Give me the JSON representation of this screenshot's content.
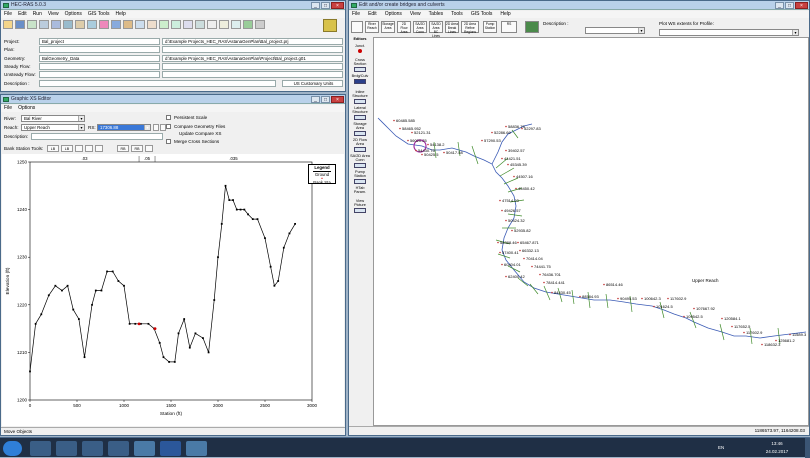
{
  "main": {
    "title": "HEC-RAS 5.0.3",
    "menu": [
      "File",
      "Edit",
      "Run",
      "View",
      "Options",
      "GIS Tools",
      "Help"
    ],
    "fields": [
      {
        "label": "Project:",
        "value": "Bal_project",
        "path": "d:\\Example Projects_HEC_RAS\\AstanaGenPlan\\Bal_project.prj"
      },
      {
        "label": "Plan:",
        "value": "",
        "path": ""
      },
      {
        "label": "Geometry:",
        "value": "BalGeometry_Data",
        "path": "d:\\Example Projects_HEC_RAS\\AstanaGenPlan\\Project\\Bal_project.g01"
      },
      {
        "label": "Steady Flow:",
        "value": "",
        "path": ""
      },
      {
        "label": "Unsteady Flow:",
        "value": "",
        "path": ""
      },
      {
        "label": "Description :",
        "value": "",
        "path": ""
      }
    ],
    "units": "US Customary Units"
  },
  "xs": {
    "title": "Graphic XS Editor",
    "menu": [
      "File",
      "Options"
    ],
    "river_label": "River:",
    "river": "Bal River",
    "reach_label": "Reach:",
    "reach": "Upper Reach",
    "rs_label": "RS:",
    "rs": "17306.88",
    "description_label": "Description:",
    "options": [
      "Persistent Scale",
      "Compare Geometry Files",
      "Update Compare XS",
      "Merge Cross Sections"
    ],
    "bank_tools_label": "Bank Station Tools:",
    "bank_buttons": [
      "LB",
      "LB",
      "RB",
      "RB"
    ],
    "regions": [
      ".03",
      ".05",
      ".035"
    ],
    "legend_title": "Legend",
    "legend_items": [
      "Ground",
      "Bank Sta"
    ],
    "status": "Move Objects"
  },
  "chart_data": {
    "type": "line",
    "title": "",
    "xlabel": "Station (ft)",
    "ylabel": "Elevation (ft)",
    "xlim": [
      0,
      3000
    ],
    "ylim": [
      1200,
      1250
    ],
    "xticks": [
      0,
      500,
      1000,
      1500,
      2000,
      2500,
      3000
    ],
    "yticks": [
      1200,
      1210,
      1220,
      1230,
      1240,
      1250
    ],
    "series": [
      {
        "name": "Ground",
        "x": [
          0,
          60,
          120,
          200,
          270,
          340,
          400,
          460,
          520,
          580,
          660,
          700,
          760,
          820,
          880,
          940,
          1000,
          1060,
          1120,
          1180,
          1260,
          1320,
          1380,
          1420,
          1480,
          1540,
          1580,
          1640,
          1700,
          1760,
          1840,
          1900,
          1960,
          2000,
          2040,
          2080,
          2120,
          2160,
          2200,
          2240,
          2280,
          2320,
          2370,
          2420,
          2500,
          2560,
          2600,
          2640,
          2700,
          2760,
          2820
        ],
        "y": [
          1206,
          1216,
          1218,
          1222,
          1224,
          1223,
          1224,
          1219,
          1217,
          1209,
          1220,
          1223,
          1223,
          1227,
          1227,
          1225,
          1224,
          1216,
          1216,
          1216,
          1216,
          1215,
          1212,
          1209,
          1208,
          1208,
          1214,
          1217,
          1211,
          1214,
          1213,
          1210,
          1221,
          1230,
          1237,
          1245,
          1242,
          1242,
          1240,
          1240,
          1240,
          1239,
          1238,
          1238,
          1234,
          1228,
          1224,
          1225,
          1232,
          1235,
          1237
        ]
      }
    ],
    "bank_stations": [
      1160,
      1330
    ]
  },
  "geo": {
    "title": "Edit and/or create bridges and culverts",
    "menu": [
      "File",
      "Edit",
      "Options",
      "View",
      "Tables",
      "Tools",
      "GIS Tools",
      "Help"
    ],
    "description_label": "Description :",
    "plot_label": "Plot WS extents for Profile:",
    "toolbar": [
      "River Reach",
      "Storage Area",
      "2D Flow Area",
      "SA/2D Area Conn",
      "SA/2D Area BC Lines",
      "2D Area Break Lines",
      "2D Area Refine Regions",
      "Pump Station",
      "RS"
    ],
    "side_tools": [
      "Editors",
      "Junct.",
      "Cross Section",
      "Brdg/Culv",
      "Inline Structure",
      "Lateral Structure",
      "Storage Area",
      "2D Flow Area",
      "SA/2D Area Conn",
      "Pump Station",
      "HTab Param.",
      "View Picture"
    ],
    "reach_label": "Upper Reach",
    "station_labels": [
      "60485.585",
      "58465.952",
      "52121.31",
      "56020.25",
      "54430.75",
      "54138.2",
      "50425.5",
      "50417.58",
      "57290.53",
      "52286.69",
      "58836.79",
      "52297.83",
      "39402.57",
      "41421.51",
      "45345.39",
      "44507.16",
      "45450.42",
      "47514.03",
      "49426.57",
      "50424.32",
      "52935.82",
      "58388.46",
      "57400.41",
      "60404.01",
      "62400.42",
      "65467.871",
      "66332.13",
      "70414.04",
      "74441.75",
      "76436.701",
      "78414.441",
      "84430.45",
      "88584.93",
      "86514.46",
      "90495.53",
      "100642.3",
      "101624.5",
      "117602.9",
      "109542.5",
      "107667.92",
      "120584.1",
      "117652.5",
      "117602.9",
      "118632.3",
      "125681.2",
      "11589.3"
    ],
    "coords": "1186573.97, 1164208.03"
  },
  "taskbar": {
    "time": "13:46",
    "date": "24.02.2017",
    "lang": "EN"
  }
}
